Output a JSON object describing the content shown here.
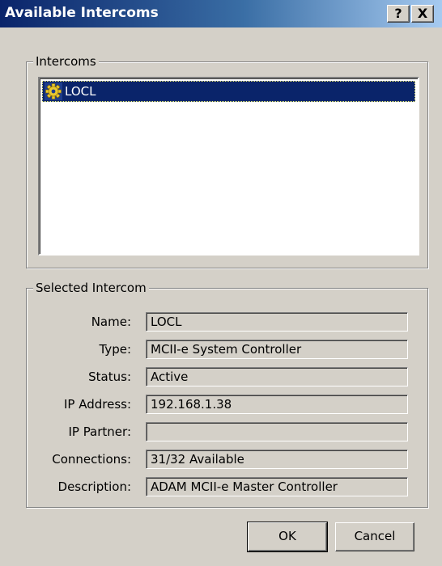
{
  "window": {
    "title": "Available Intercoms",
    "help_label": "?",
    "close_label": "X"
  },
  "intercoms_group": {
    "legend": "Intercoms",
    "items": [
      {
        "label": "LOCL",
        "icon": "gear-icon",
        "selected": true
      }
    ]
  },
  "selected_group": {
    "legend": "Selected Intercom",
    "fields": [
      {
        "label": "Name:",
        "value": "LOCL"
      },
      {
        "label": "Type:",
        "value": "MCII-e System Controller"
      },
      {
        "label": "Status:",
        "value": "Active"
      },
      {
        "label": "IP Address:",
        "value": "192.168.1.38"
      },
      {
        "label": "IP Partner:",
        "value": ""
      },
      {
        "label": "Connections:",
        "value": "31/32 Available"
      },
      {
        "label": "Description:",
        "value": "ADAM MCII-e Master Controller"
      }
    ]
  },
  "buttons": {
    "ok_label": "OK",
    "cancel_label": "Cancel"
  },
  "colors": {
    "title_gradient_start": "#0a246a",
    "title_gradient_end": "#a6caf0",
    "selection": "#0a246a",
    "face": "#d4d0c8"
  }
}
